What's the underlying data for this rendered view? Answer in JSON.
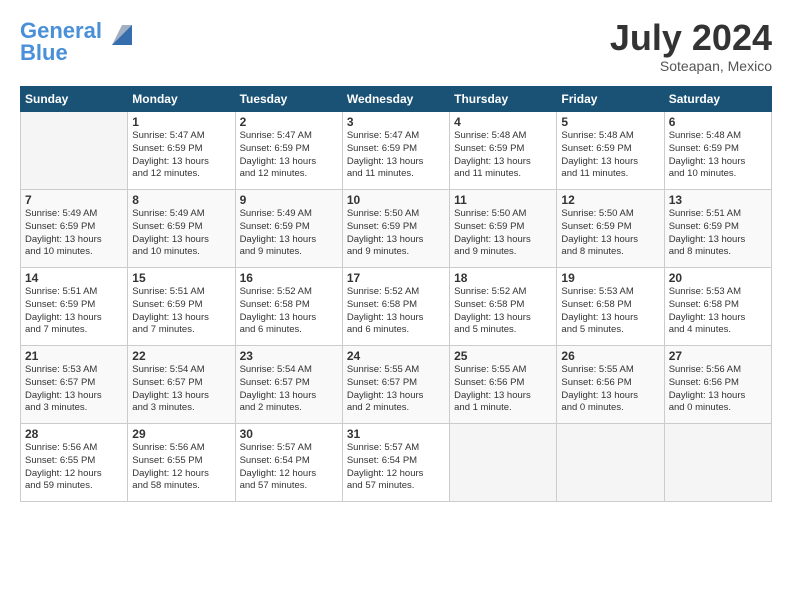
{
  "logo": {
    "line1": "General",
    "line2": "Blue"
  },
  "title": "July 2024",
  "subtitle": "Soteapan, Mexico",
  "days_header": [
    "Sunday",
    "Monday",
    "Tuesday",
    "Wednesday",
    "Thursday",
    "Friday",
    "Saturday"
  ],
  "weeks": [
    [
      {
        "num": "",
        "info": ""
      },
      {
        "num": "1",
        "info": "Sunrise: 5:47 AM\nSunset: 6:59 PM\nDaylight: 13 hours\nand 12 minutes."
      },
      {
        "num": "2",
        "info": "Sunrise: 5:47 AM\nSunset: 6:59 PM\nDaylight: 13 hours\nand 12 minutes."
      },
      {
        "num": "3",
        "info": "Sunrise: 5:47 AM\nSunset: 6:59 PM\nDaylight: 13 hours\nand 11 minutes."
      },
      {
        "num": "4",
        "info": "Sunrise: 5:48 AM\nSunset: 6:59 PM\nDaylight: 13 hours\nand 11 minutes."
      },
      {
        "num": "5",
        "info": "Sunrise: 5:48 AM\nSunset: 6:59 PM\nDaylight: 13 hours\nand 11 minutes."
      },
      {
        "num": "6",
        "info": "Sunrise: 5:48 AM\nSunset: 6:59 PM\nDaylight: 13 hours\nand 10 minutes."
      }
    ],
    [
      {
        "num": "7",
        "info": "Sunrise: 5:49 AM\nSunset: 6:59 PM\nDaylight: 13 hours\nand 10 minutes."
      },
      {
        "num": "8",
        "info": "Sunrise: 5:49 AM\nSunset: 6:59 PM\nDaylight: 13 hours\nand 10 minutes."
      },
      {
        "num": "9",
        "info": "Sunrise: 5:49 AM\nSunset: 6:59 PM\nDaylight: 13 hours\nand 9 minutes."
      },
      {
        "num": "10",
        "info": "Sunrise: 5:50 AM\nSunset: 6:59 PM\nDaylight: 13 hours\nand 9 minutes."
      },
      {
        "num": "11",
        "info": "Sunrise: 5:50 AM\nSunset: 6:59 PM\nDaylight: 13 hours\nand 9 minutes."
      },
      {
        "num": "12",
        "info": "Sunrise: 5:50 AM\nSunset: 6:59 PM\nDaylight: 13 hours\nand 8 minutes."
      },
      {
        "num": "13",
        "info": "Sunrise: 5:51 AM\nSunset: 6:59 PM\nDaylight: 13 hours\nand 8 minutes."
      }
    ],
    [
      {
        "num": "14",
        "info": "Sunrise: 5:51 AM\nSunset: 6:59 PM\nDaylight: 13 hours\nand 7 minutes."
      },
      {
        "num": "15",
        "info": "Sunrise: 5:51 AM\nSunset: 6:59 PM\nDaylight: 13 hours\nand 7 minutes."
      },
      {
        "num": "16",
        "info": "Sunrise: 5:52 AM\nSunset: 6:58 PM\nDaylight: 13 hours\nand 6 minutes."
      },
      {
        "num": "17",
        "info": "Sunrise: 5:52 AM\nSunset: 6:58 PM\nDaylight: 13 hours\nand 6 minutes."
      },
      {
        "num": "18",
        "info": "Sunrise: 5:52 AM\nSunset: 6:58 PM\nDaylight: 13 hours\nand 5 minutes."
      },
      {
        "num": "19",
        "info": "Sunrise: 5:53 AM\nSunset: 6:58 PM\nDaylight: 13 hours\nand 5 minutes."
      },
      {
        "num": "20",
        "info": "Sunrise: 5:53 AM\nSunset: 6:58 PM\nDaylight: 13 hours\nand 4 minutes."
      }
    ],
    [
      {
        "num": "21",
        "info": "Sunrise: 5:53 AM\nSunset: 6:57 PM\nDaylight: 13 hours\nand 3 minutes."
      },
      {
        "num": "22",
        "info": "Sunrise: 5:54 AM\nSunset: 6:57 PM\nDaylight: 13 hours\nand 3 minutes."
      },
      {
        "num": "23",
        "info": "Sunrise: 5:54 AM\nSunset: 6:57 PM\nDaylight: 13 hours\nand 2 minutes."
      },
      {
        "num": "24",
        "info": "Sunrise: 5:55 AM\nSunset: 6:57 PM\nDaylight: 13 hours\nand 2 minutes."
      },
      {
        "num": "25",
        "info": "Sunrise: 5:55 AM\nSunset: 6:56 PM\nDaylight: 13 hours\nand 1 minute."
      },
      {
        "num": "26",
        "info": "Sunrise: 5:55 AM\nSunset: 6:56 PM\nDaylight: 13 hours\nand 0 minutes."
      },
      {
        "num": "27",
        "info": "Sunrise: 5:56 AM\nSunset: 6:56 PM\nDaylight: 13 hours\nand 0 minutes."
      }
    ],
    [
      {
        "num": "28",
        "info": "Sunrise: 5:56 AM\nSunset: 6:55 PM\nDaylight: 12 hours\nand 59 minutes."
      },
      {
        "num": "29",
        "info": "Sunrise: 5:56 AM\nSunset: 6:55 PM\nDaylight: 12 hours\nand 58 minutes."
      },
      {
        "num": "30",
        "info": "Sunrise: 5:57 AM\nSunset: 6:54 PM\nDaylight: 12 hours\nand 57 minutes."
      },
      {
        "num": "31",
        "info": "Sunrise: 5:57 AM\nSunset: 6:54 PM\nDaylight: 12 hours\nand 57 minutes."
      },
      {
        "num": "",
        "info": ""
      },
      {
        "num": "",
        "info": ""
      },
      {
        "num": "",
        "info": ""
      }
    ]
  ]
}
